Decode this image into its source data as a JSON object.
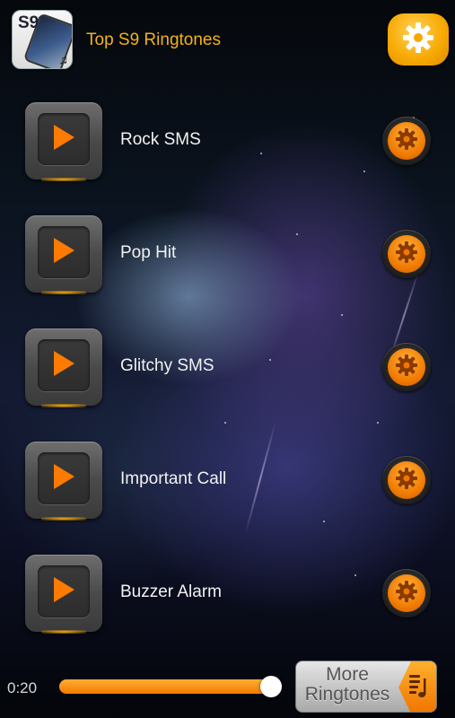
{
  "header": {
    "app_title": "Top S9 Ringtones",
    "app_icon_text": "S9",
    "app_icon_note": "♫",
    "settings_icon": "gear-icon"
  },
  "ringtones": [
    {
      "label": "Rock SMS"
    },
    {
      "label": "Pop Hit"
    },
    {
      "label": "Glitchy SMS"
    },
    {
      "label": "Important Call"
    },
    {
      "label": "Buzzer Alarm"
    }
  ],
  "player": {
    "elapsed": "0:20",
    "progress": 1.0
  },
  "more_button": {
    "label_line1": "More",
    "label_line2": "Ringtones",
    "icon": "music-list-icon"
  },
  "colors": {
    "accent": "#f7a800",
    "title": "#f3b21a",
    "seek": "#f57a00"
  }
}
